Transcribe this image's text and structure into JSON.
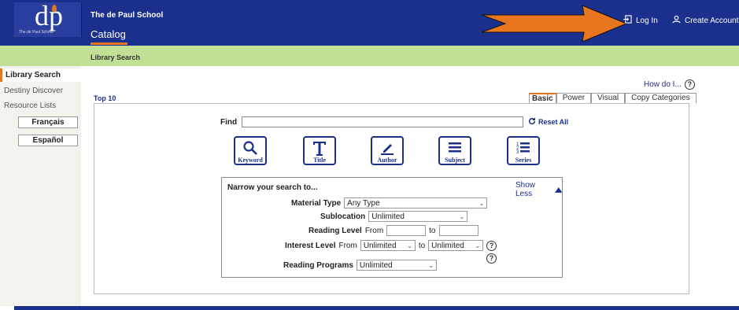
{
  "header": {
    "logo_text": "dp",
    "logo_sub": "The de Paul School",
    "school_name": "The de Paul School",
    "catalog": "Catalog",
    "login": "Log In",
    "create_account": "Create Account"
  },
  "breadcrumb": "Library Search",
  "sidebar": {
    "items": [
      {
        "label": "Library Search"
      },
      {
        "label": "Destiny Discover"
      },
      {
        "label": "Resource Lists"
      }
    ],
    "languages": [
      "Français",
      "Español"
    ]
  },
  "help": {
    "how_do_i": "How do I...",
    "icon_text": "?"
  },
  "top10": "Top 10",
  "tabs": [
    "Basic",
    "Power",
    "Visual",
    "Copy Categories"
  ],
  "search": {
    "find_label": "Find",
    "find_value": "",
    "reset": "Reset All",
    "buttons": [
      {
        "label": "Keyword"
      },
      {
        "label": "Title"
      },
      {
        "label": "Author"
      },
      {
        "label": "Subject"
      },
      {
        "label": "Series"
      }
    ]
  },
  "narrow": {
    "title": "Narrow your search to...",
    "show_less": "Show Less",
    "material_type_label": "Material Type",
    "material_type_value": "Any Type",
    "sublocation_label": "Sublocation",
    "sublocation_value": "Unlimited",
    "reading_level_label": "Reading Level",
    "from": "From",
    "to": "to",
    "interest_level_label": "Interest Level",
    "interest_from_value": "Unlimited",
    "interest_to_value": "Unlimited",
    "reading_programs_label": "Reading Programs",
    "reading_programs_value": "Unlimited"
  },
  "colors": {
    "navy": "#1b2f8c",
    "accent": "#e8761f",
    "green": "#c2df96"
  }
}
